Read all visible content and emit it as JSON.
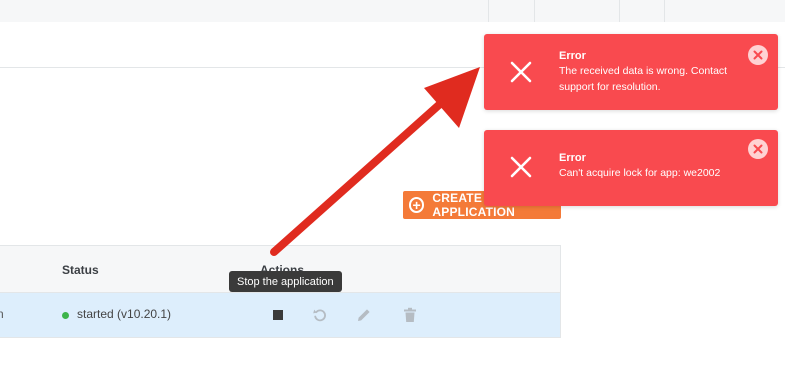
{
  "create_button": {
    "label": "CREATE APPLICATION",
    "icon": "plus-circle-icon",
    "color": "#f47a38"
  },
  "table": {
    "headers": {
      "status": "Status",
      "actions": "Actions"
    },
    "rows": [
      {
        "name": "n",
        "status": "started (v10.20.1)",
        "status_color": "#3cb44b",
        "actions": [
          "stop-icon",
          "restart-icon",
          "edit-icon",
          "delete-icon"
        ]
      }
    ]
  },
  "tooltip": {
    "text": "Stop the application"
  },
  "toasts": [
    {
      "title": "Error",
      "message": "The received data is wrong. Contact support for resolution.",
      "icon": "error-x-icon",
      "close_icon": "close-icon",
      "color": "#f94a4f"
    },
    {
      "title": "Error",
      "message": "Can't acquire lock for app: we2002",
      "icon": "error-x-icon",
      "close_icon": "close-icon",
      "color": "#f94a4f"
    }
  ],
  "annotation_arrow": {
    "color": "#e02b1f"
  }
}
